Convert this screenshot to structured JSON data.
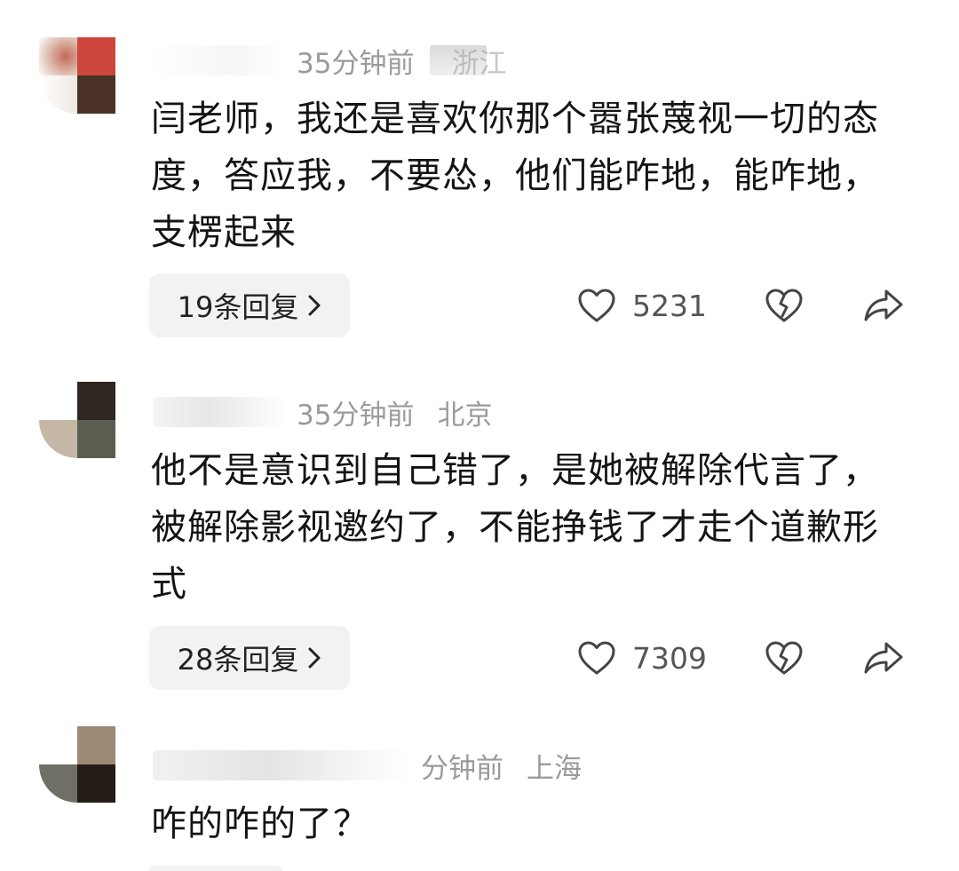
{
  "comments": [
    {
      "time": "35分钟前",
      "location": "浙江",
      "text": "闫老师，我还是喜欢你那个嚣张蔑视一切的态度，答应我，不要怂，他们能咋地，能咋地，支楞起来",
      "replies_label": "19条回复",
      "likes": "5231",
      "avatar_colors": [
        "#c9413a",
        "#cf4b3f",
        "#c99b8a",
        "#4b3227"
      ]
    },
    {
      "time": "35分钟前",
      "location": "北京",
      "text": "他不是意识到自己错了，是她被解除代言了，被解除影视邀约了，不能挣钱了才走个道歉形式",
      "replies_label": "28条回复",
      "likes": "7309",
      "avatar_colors": [
        "#ffffff",
        "#2f2620",
        "#c5b7a6",
        "#5b5d51"
      ]
    },
    {
      "time": "分钟前",
      "location": "上海",
      "text": "咋的咋的了？",
      "avatar_colors": [
        "#ffffff",
        "#9d8a74",
        "#6f6f67",
        "#241d15"
      ]
    }
  ],
  "colors": {
    "meta_text": "#9a9a9a",
    "body_text": "#141414",
    "button_bg": "#f2f2f2",
    "icon_stroke": "#333333"
  },
  "icons": {
    "reply_chevron": "chevron-right-icon",
    "like": "heart-outline-icon",
    "dislike": "broken-heart-icon",
    "share": "share-arrow-icon"
  }
}
